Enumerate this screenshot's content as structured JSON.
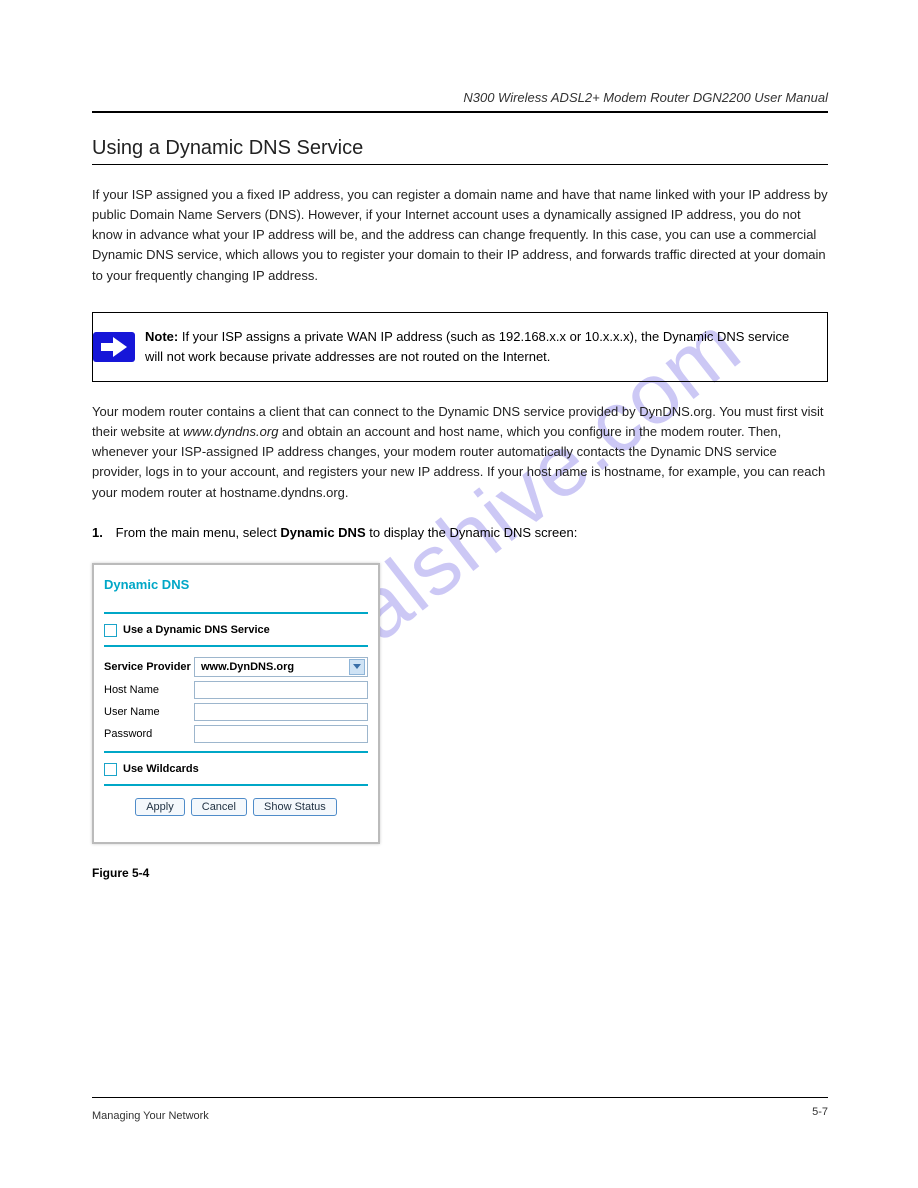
{
  "watermark": "manualshive.com",
  "header": {
    "doc_title": "N300 Wireless ADSL2+ Modem Router DGN2200 User Manual"
  },
  "section": {
    "title": "Using a Dynamic DNS Service"
  },
  "paragraph1": "If your ISP assigned you a fixed IP address, you can register a domain name and have that name linked with your IP address by public Domain Name Servers (DNS). However, if your Internet account uses a dynamically assigned IP address, you do not know in advance what your IP address will be, and the address can change frequently. In this case, you can use a commercial Dynamic DNS service, which allows you to register your domain to their IP address, and forwards traffic directed at your domain to your frequently changing IP address.",
  "note": {
    "label": "Note:",
    "text": "If your ISP assigns a private WAN IP address (such as 192.168.x.x or 10.x.x.x), the Dynamic DNS service will not work because private addresses are not routed on the Internet."
  },
  "paragraph2_pre": "Your modem router contains a client that can connect to the Dynamic DNS service provided by DynDNS.org. You must first visit their website at ",
  "paragraph2_url": "www.dyndns.org",
  "paragraph2_post": " and obtain an account and host name, which you configure in the modem router. Then, whenever your ISP-assigned IP address changes, your modem router automatically contacts the Dynamic DNS service provider, logs in to your account, and registers your new IP address. If your host name is hostname, for example, you can reach your modem router at hostname.dyndns.org.",
  "step": {
    "num": "1.",
    "text_pre": "From the main menu, select ",
    "text_bold": "Dynamic DNS",
    "text_post": " to display the Dynamic DNS screen:"
  },
  "panel": {
    "title": "Dynamic DNS",
    "chk1": "Use a Dynamic DNS Service",
    "provider_label": "Service Provider",
    "provider_value": "www.DynDNS.org",
    "host_label": "Host Name",
    "user_label": "User Name",
    "pass_label": "Password",
    "chk2": "Use Wildcards",
    "btn_apply": "Apply",
    "btn_cancel": "Cancel",
    "btn_status": "Show Status"
  },
  "figure_caption": "Figure 5-4",
  "footer": {
    "left": "Managing Your Network",
    "right": "5-7"
  }
}
